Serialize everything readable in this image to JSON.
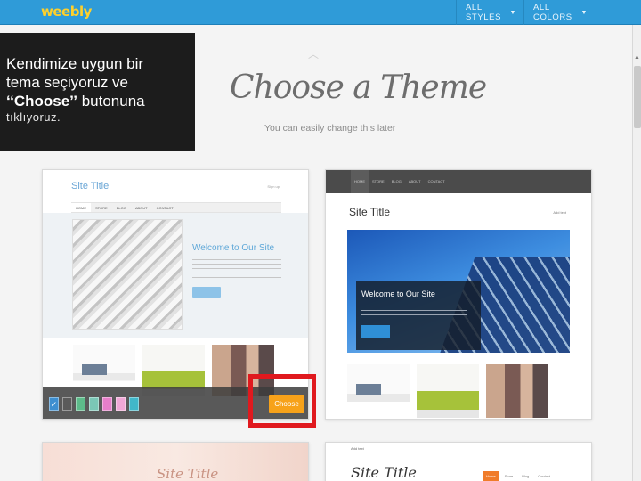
{
  "app": {
    "logo": "weebly"
  },
  "topbar": {
    "styles_label": "ALL STYLES",
    "colors_label": "ALL COLORS",
    "caret_icon": "caret-down-icon"
  },
  "callout": {
    "line1": "Kendimize uygun bir",
    "line2": "tema seçiyoruz ve",
    "line3_quote": "‘‘Choose’’",
    "line3_rest": " butonuna",
    "line4": "tıklıyoruz."
  },
  "main": {
    "title": "Choose a Theme",
    "subtitle": "You can easily change this later"
  },
  "themes": [
    {
      "site_title": "Site Title",
      "signup": "Sign up",
      "nav": [
        "HOME",
        "STORE",
        "BLOG",
        "ABOUT",
        "CONTACT"
      ],
      "welcome": "Welcome to Our Site",
      "choose_label": "Choose",
      "swatches": [
        "#3e8fd0",
        "#5a5a5a",
        "#5dbb8a",
        "#7bc7b6",
        "#e67ec9",
        "#f0a8d6",
        "#41b7c9"
      ]
    },
    {
      "nav": [
        "HOME",
        "STORE",
        "BLOG",
        "ABOUT",
        "CONTACT"
      ],
      "site_title": "Site Title",
      "signup": "Add text",
      "welcome": "Welcome to Our Site",
      "button": "Learn More"
    },
    {
      "site_title": "Site Title"
    },
    {
      "add_text": "Add text",
      "site_title": "Site Title",
      "nav": [
        "Home",
        "Store",
        "Blog",
        "Contact"
      ]
    }
  ]
}
